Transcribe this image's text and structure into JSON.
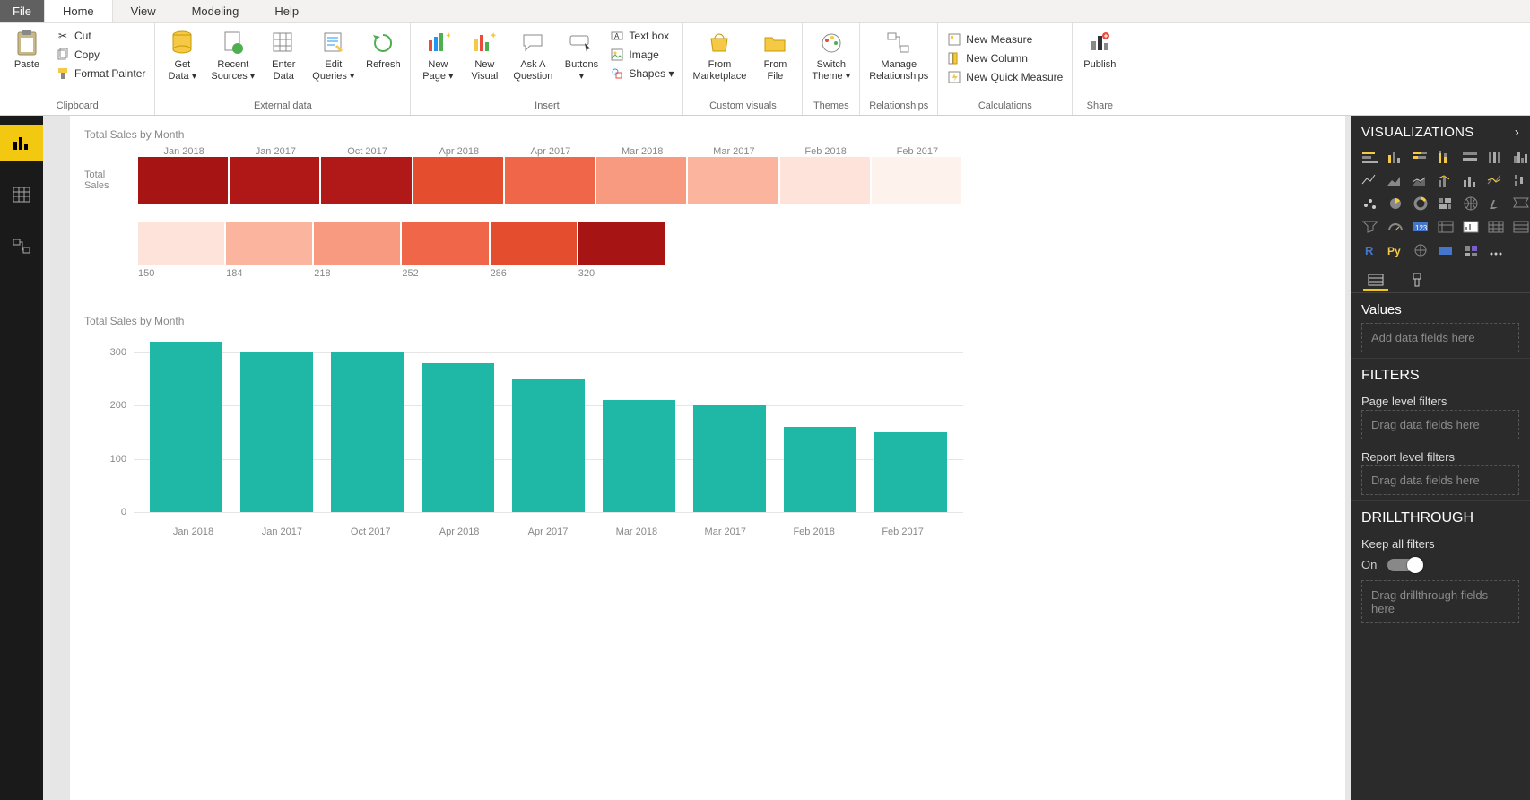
{
  "menu": {
    "file": "File",
    "tabs": [
      "Home",
      "View",
      "Modeling",
      "Help"
    ],
    "active": "Home"
  },
  "ribbon": {
    "groups": {
      "clipboard": {
        "label": "Clipboard",
        "paste": "Paste",
        "cut": "Cut",
        "copy": "Copy",
        "format_painter": "Format Painter"
      },
      "external": {
        "label": "External data",
        "get_data": "Get\nData ▾",
        "recent": "Recent\nSources ▾",
        "enter": "Enter\nData",
        "edit_q": "Edit\nQueries ▾",
        "refresh": "Refresh"
      },
      "insert": {
        "label": "Insert",
        "new_page": "New\nPage ▾",
        "new_visual": "New\nVisual",
        "aska": "Ask A\nQuestion",
        "buttons": "Buttons\n▾",
        "textbox": "Text box",
        "image": "Image",
        "shapes": "Shapes ▾"
      },
      "custom": {
        "label": "Custom visuals",
        "market": "From\nMarketplace",
        "file": "From\nFile"
      },
      "themes": {
        "label": "Themes",
        "switch": "Switch\nTheme ▾"
      },
      "rel": {
        "label": "Relationships",
        "manage": "Manage\nRelationships"
      },
      "calc": {
        "label": "Calculations",
        "measure": "New Measure",
        "column": "New Column",
        "quick": "New Quick Measure"
      },
      "share": {
        "label": "Share",
        "publish": "Publish"
      }
    }
  },
  "vispane": {
    "title": "VISUALIZATIONS",
    "values_title": "Values",
    "values_placeholder": "Add data fields here",
    "filters_title": "FILTERS",
    "page_filters": "Page level filters",
    "report_filters": "Report level filters",
    "drag_placeholder": "Drag data fields here",
    "drill_title": "DRILLTHROUGH",
    "keep_all": "Keep all filters",
    "on": "On",
    "drill_placeholder": "Drag drillthrough fields here"
  },
  "chart_data": [
    {
      "type": "heatmap",
      "title": "Total Sales by Month",
      "ylabel": "Total Sales",
      "categories": [
        "Jan 2018",
        "Jan 2017",
        "Oct 2017",
        "Apr 2018",
        "Apr 2017",
        "Mar 2018",
        "Mar 2017",
        "Feb 2018",
        "Feb 2017"
      ],
      "values": [
        320,
        300,
        300,
        280,
        250,
        210,
        200,
        160,
        150
      ],
      "colors": [
        "#a61414",
        "#b01818",
        "#b11919",
        "#e44d2e",
        "#ef6648",
        "#f79a7f",
        "#fbb49d",
        "#fde3d9",
        "#fef2ed"
      ],
      "scale": {
        "ticks": [
          150,
          184,
          218,
          252,
          286,
          320
        ],
        "colors": [
          "#fde3d9",
          "#fbb49d",
          "#f79a7f",
          "#ef6648",
          "#e44d2e",
          "#a61414"
        ]
      }
    },
    {
      "type": "bar",
      "title": "Total Sales by Month",
      "categories": [
        "Jan 2018",
        "Jan 2017",
        "Oct 2017",
        "Apr 2018",
        "Apr 2017",
        "Mar 2018",
        "Mar 2017",
        "Feb 2018",
        "Feb 2017"
      ],
      "values": [
        320,
        300,
        300,
        280,
        250,
        210,
        200,
        160,
        150
      ],
      "yticks": [
        0,
        100,
        200,
        300
      ],
      "ylim": [
        0,
        320
      ],
      "bar_color": "#1fb8a6"
    }
  ]
}
